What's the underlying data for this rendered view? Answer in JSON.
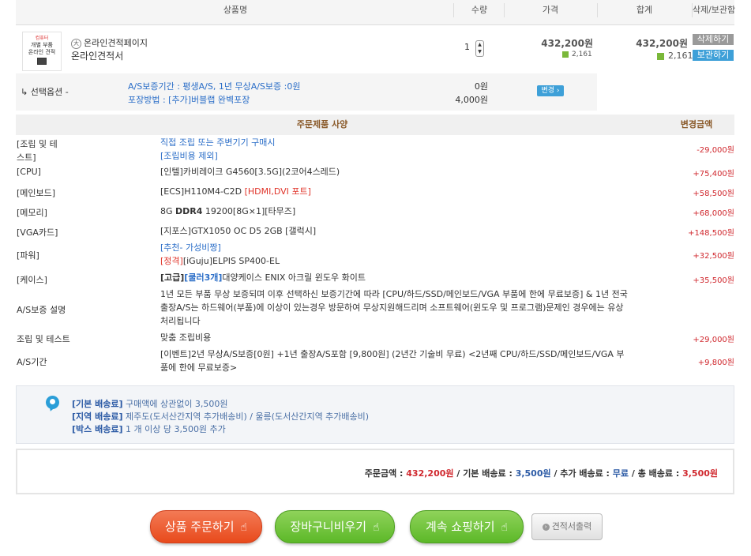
{
  "header": {
    "col_product": "상품명",
    "col_qty": "수량",
    "col_price": "가격",
    "col_total": "합계",
    "col_action": "삭제/보관함"
  },
  "product": {
    "thumb_top": "컴퓨터",
    "thumb_line1": "개별 부품",
    "thumb_line2": "온라인 견적",
    "name_line1": "온라인견적페이지",
    "name_line2": "온라인견적서",
    "qty": "1",
    "price": "432,200원",
    "points": "2,161",
    "total": "432,200원",
    "total_points": "2,161",
    "delete_label": "삭제하기",
    "keep_label": "보관하기"
  },
  "option": {
    "label": "선택옵션 -",
    "line1": "A/S보증기간 : 평생A/S, 1년 무상A/S보증 :0원",
    "line2": "포장방법 : [추가]버블랩 완벽포장",
    "price1": "0원",
    "price2": "4,000원",
    "change_label": "변경"
  },
  "spec": {
    "header_left": "주문제품 사양",
    "header_right": "변경금액",
    "rows": [
      {
        "label": "[조립 및 테스트]",
        "line1": "직접 조립 또는 주변기기 구매시",
        "line2": "[조립비용 제외]",
        "price": "-29,000원"
      },
      {
        "label": "[CPU]",
        "content": "[인텔]카비레이크 G4560[3.5G](2코어4스레드)",
        "price": "+75,400원"
      },
      {
        "label": "[메인보드]",
        "content": "[ECS]H110M4-C2D ",
        "content_red": "[HDMI,DVI 포트]",
        "price": "+58,500원"
      },
      {
        "label": "[메모리]",
        "content_a": "8G ",
        "content_bold": "DDR4",
        "content_b": " 19200[8G×1][타무즈]",
        "price": "+68,000원"
      },
      {
        "label": "[VGA카드]",
        "content": "[지포스]GTX1050 OC D5 2GB [갤럭시]",
        "price": "+148,500원"
      },
      {
        "label": "[파워]",
        "line1": "[추천- 가성비짱]",
        "line2_red": "[정격]",
        "line2": "[iGuju]ELPIS SP400-EL",
        "price": "+32,500원"
      },
      {
        "label": "[케이스]",
        "content_bold": "[고급]",
        "content_blue": "[쿨러3개]",
        "content": "대양케이스 ENIX 아크릴 윈도우 화이트",
        "price": "+35,500원"
      },
      {
        "label": "A/S보증 설명",
        "content": "1년 모든 부품 무상 보증되며 이후 선택하신 보증기간에 따라 [CPU/하드/SSD/메인보드/VGA 부품에 한에 무료보증] & 1년 전국 출장A/S는 하드웨어(부품)에 이상이 있는경우 방문하여 무상지원해드리며 소프트웨어(윈도우 및 프로그램)문제인 경우에는 유상처리됩니다",
        "price": ""
      },
      {
        "label": "조립 및 테스트",
        "content": "맞춤 조립비용",
        "price": "+29,000원"
      },
      {
        "label": "A/S기간",
        "content": "[이벤트]2년 무상A/S보증[0원] +1년 출장A/S포함 [9,800원] (2년간 기술비 무료) <2년째 CPU/하드/SSD/메인보드/VGA 부품에 한에 무료보증>",
        "price": "+9,800원"
      }
    ]
  },
  "shipping": {
    "line1_key": "[기본 배송료]",
    "line1_val": " 구매액에 상관없이 3,500원",
    "line2_key": "[지역 배송료]",
    "line2_val": " 제주도(도서산간지역 추가배송비) / 울릉(도서산간지역 추가배송비)",
    "line3_key": "[박스 배송료]",
    "line3_val": " 1 개 이상 당 3,500원 추가"
  },
  "summary": {
    "order_label": "주문금액 : ",
    "order_value": "432,200원",
    "base_label": " / 기본 배송료 : ",
    "base_value": "3,500원",
    "extra_label": " / 추가 배송료 : ",
    "extra_value": "무료",
    "total_label": " / 총 배송료 : ",
    "total_value": "3,500원"
  },
  "buttons": {
    "order": "상품 주문하기",
    "clear": "장바구니비우기",
    "continue": "계속 쇼핑하기",
    "estimate": "견적서출력"
  },
  "colors": {
    "accent_blue": "#3ea0d8",
    "price_red": "#d0282e",
    "order_btn": "#e84a1c",
    "green_btn": "#5cb828"
  }
}
